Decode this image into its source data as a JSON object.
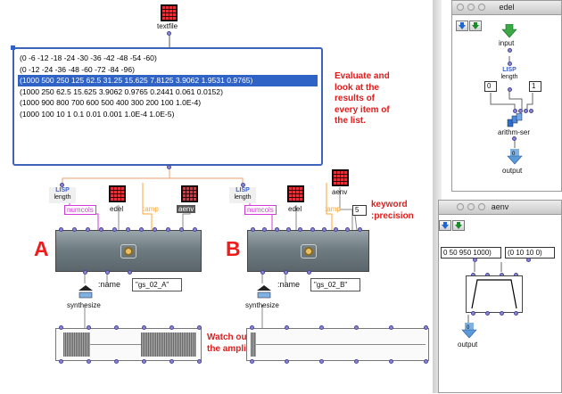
{
  "patch": {
    "textfile_label": "textfile",
    "text_lines": [
      "(0 -6 -12 -18 -24 -30 -36 -42 -48 -54 -60)",
      "(0 -12 -24 -36 -48 -60 -72 -84 -96)",
      "(1000 500 250 125 62.5 31.25 15.625 7.8125 3.9062 1.9531 0.9765)",
      "(1000 250 62.5 15.625 3.9062 0.9765 0.2441 0.061 0.0152)",
      "(1000 900 800 700 600 500 400 300 200 100 1.0E-4)",
      "(1000 100 10 1 0.1 0.01 0.001 1.0E-4 1.0E-5)"
    ],
    "selected_line": 2,
    "comment_evaluate": [
      "Evaluate and",
      "look at the",
      "results of",
      "every item of",
      "the list."
    ],
    "lisp": "LISP",
    "length": "length",
    "numcols": "numcols",
    "edel": "edel",
    "amp": ":amp",
    "aenv": "aenv",
    "precision_value": "5",
    "keyword_comment": [
      "keyword",
      ":precision"
    ],
    "label_a": "A",
    "label_b": "B",
    "name_kw": ":name",
    "name_a": "\"gs_02_A\"",
    "name_b": "\"gs_02_B\"",
    "synthesize": "synthesize",
    "amplitude_comment": [
      "Watch out at",
      "the amplitude"
    ]
  },
  "edel_window": {
    "title": "edel",
    "input": "input",
    "lisp": "LISP",
    "length": "length",
    "num_left": "0",
    "num_right": "1",
    "arithm": "arithm-ser",
    "output": "output"
  },
  "aenv_window": {
    "title": "aenv",
    "list_left": "0 50 950 1000)",
    "list_right": "(0 10 10 0)",
    "output": "output"
  },
  "colors": {
    "accent": "#e11b1b",
    "selection": "#2f63c5",
    "magenta": "#d23bd6",
    "orange": "#ffa531"
  }
}
